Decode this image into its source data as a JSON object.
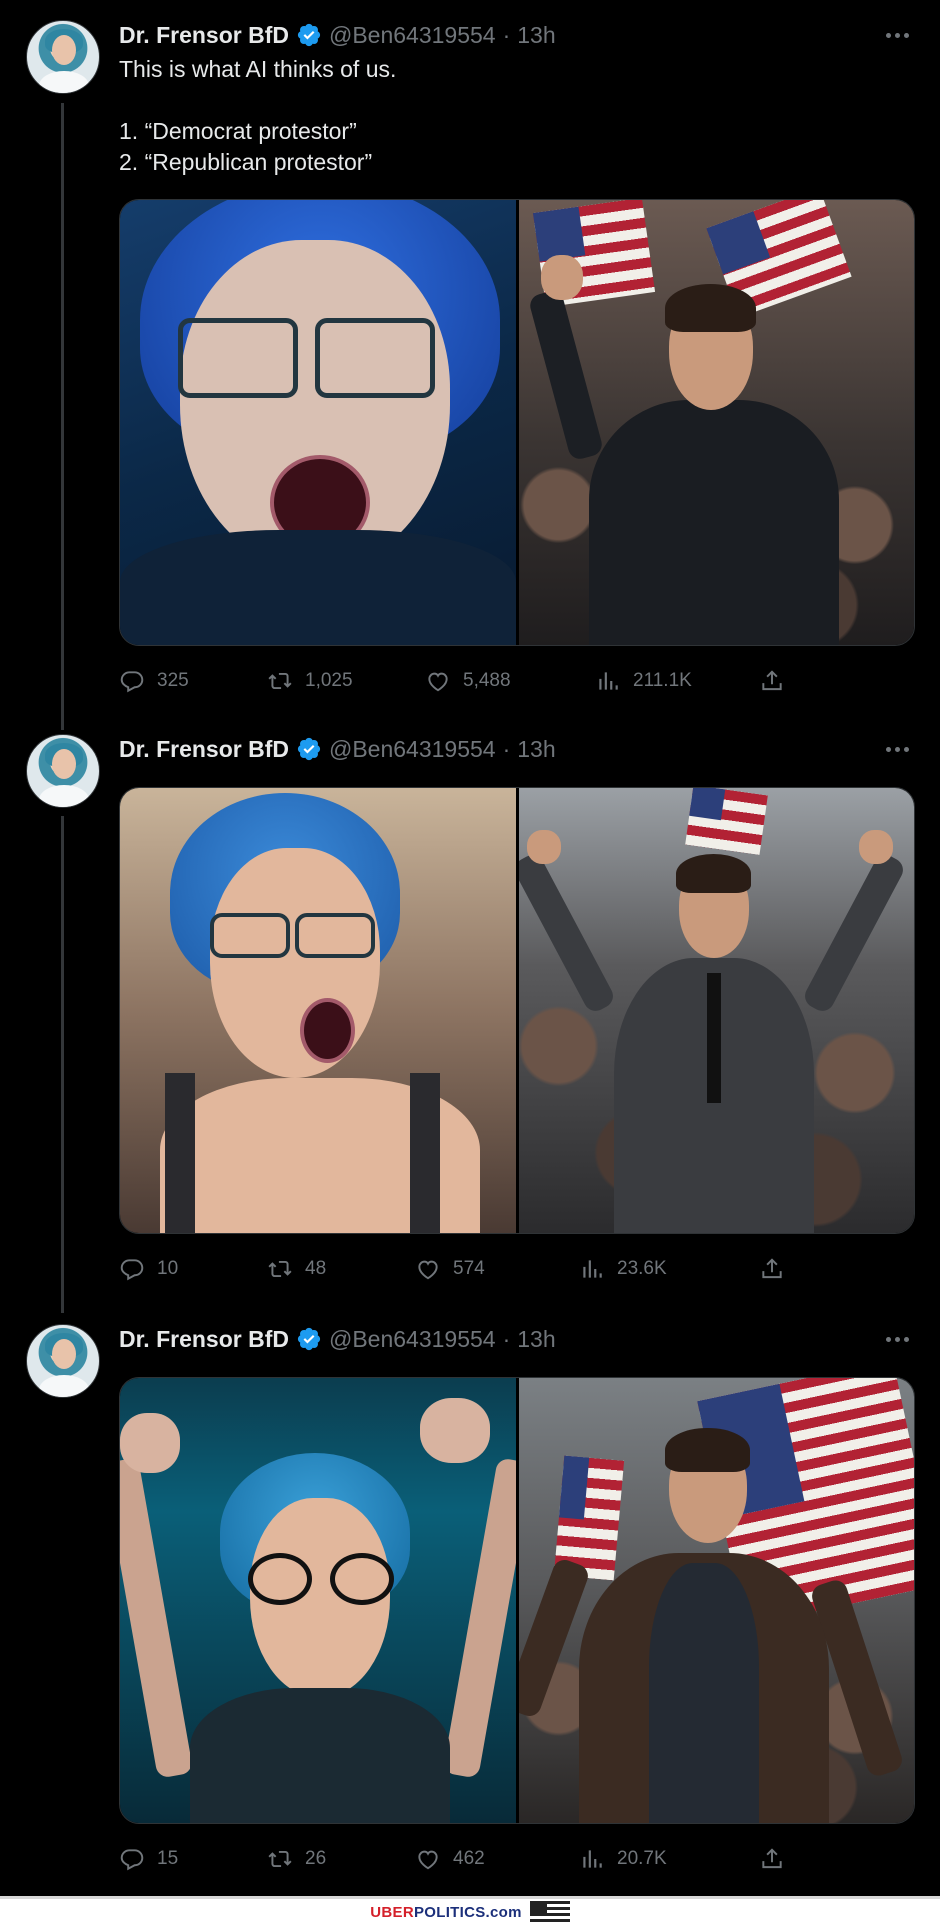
{
  "tweets": [
    {
      "name": "Dr. Frensor BfD",
      "handle": "@Ben64319554",
      "separator": "·",
      "time": "13h",
      "text": "This is what AI thinks of us.\n\n1. “Democrat protestor”\n2. “Republican protestor”",
      "stats": {
        "replies": "325",
        "retweets": "1,025",
        "likes": "5,488",
        "views": "211.1K"
      }
    },
    {
      "name": "Dr. Frensor BfD",
      "handle": "@Ben64319554",
      "separator": "·",
      "time": "13h",
      "text": "",
      "stats": {
        "replies": "10",
        "retweets": "48",
        "likes": "574",
        "views": "23.6K"
      }
    },
    {
      "name": "Dr. Frensor BfD",
      "handle": "@Ben64319554",
      "separator": "·",
      "time": "13h",
      "text": "",
      "stats": {
        "replies": "15",
        "retweets": "26",
        "likes": "462",
        "views": "20.7K"
      }
    }
  ],
  "icons": {
    "verified": "verified-badge-icon",
    "more": "more-options-icon",
    "reply": "reply-icon",
    "retweet": "retweet-icon",
    "like": "heart-icon",
    "views": "views-chart-icon",
    "share": "share-icon"
  },
  "colors": {
    "background": "#000000",
    "verified": "#1d9bf0",
    "muted": "#71767b",
    "text": "#e7e9ea"
  },
  "footer": {
    "brand_part1": "UBER",
    "brand_part2": "POLITICS.com"
  }
}
